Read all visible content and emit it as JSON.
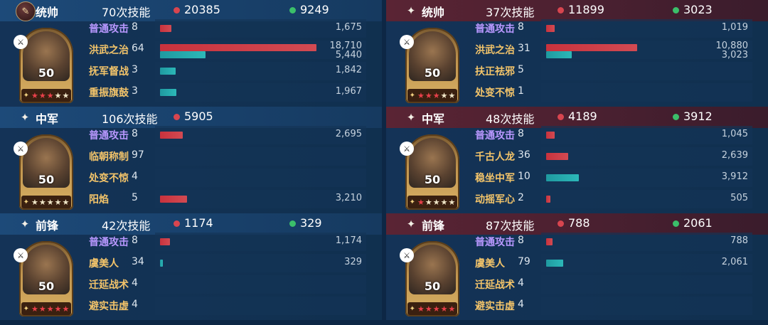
{
  "left": {
    "sections": [
      {
        "role": "统帅",
        "role_icon": "commander-badge-icon",
        "skill_count": "70次技能",
        "damage": "20385",
        "heal": "9249",
        "level": "50",
        "stars": 3,
        "skills": [
          {
            "name": "普通攻击",
            "color": "purple",
            "count": "8",
            "damage": "1,675",
            "damage_frac": 0.071,
            "heal": "",
            "heal_frac": 0
          },
          {
            "name": "洪武之治",
            "color": "gold",
            "count": "64",
            "damage": "18,710",
            "damage_frac": 1.0,
            "heal": "5,440",
            "heal_frac": 0.29
          },
          {
            "name": "抚军督战",
            "color": "gold",
            "count": "3",
            "damage": "",
            "damage_frac": 0,
            "heal": "1,842",
            "heal_frac": 0.098
          },
          {
            "name": "重振旗鼓",
            "color": "gold",
            "count": "3",
            "damage": "",
            "damage_frac": 0,
            "heal": "1,967",
            "heal_frac": 0.105
          }
        ]
      },
      {
        "role": "中军",
        "role_icon": "sparkle-icon",
        "skill_count": "106次技能",
        "damage": "5905",
        "heal": "",
        "level": "50",
        "stars": 0,
        "skills": [
          {
            "name": "普通攻击",
            "color": "purple",
            "count": "8",
            "damage": "2,695",
            "damage_frac": 0.144,
            "heal": "",
            "heal_frac": 0
          },
          {
            "name": "临朝称制",
            "color": "gold",
            "count": "97",
            "damage": "",
            "damage_frac": 0,
            "heal": "",
            "heal_frac": 0
          },
          {
            "name": "处变不惊",
            "color": "gold",
            "count": "4",
            "damage": "",
            "damage_frac": 0,
            "heal": "",
            "heal_frac": 0
          },
          {
            "name": "阳焰",
            "color": "gold",
            "count": "5",
            "damage": "3,210",
            "damage_frac": 0.172,
            "heal": "",
            "heal_frac": 0
          }
        ]
      },
      {
        "role": "前锋",
        "role_icon": "sparkle-icon",
        "skill_count": "42次技能",
        "damage": "1174",
        "heal": "329",
        "level": "50",
        "stars": 5,
        "skills": [
          {
            "name": "普通攻击",
            "color": "purple",
            "count": "8",
            "damage": "1,174",
            "damage_frac": 0.063,
            "heal": "",
            "heal_frac": 0
          },
          {
            "name": "虞美人",
            "color": "gold",
            "count": "34",
            "damage": "",
            "damage_frac": 0,
            "heal": "329",
            "heal_frac": 0.018
          },
          {
            "name": "迁延战术",
            "color": "gold",
            "count": "4",
            "damage": "",
            "damage_frac": 0,
            "heal": "",
            "heal_frac": 0
          },
          {
            "name": "避实击虚",
            "color": "gold",
            "count": "4",
            "damage": "",
            "damage_frac": 0,
            "heal": "",
            "heal_frac": 0
          }
        ]
      }
    ]
  },
  "right": {
    "sections": [
      {
        "role": "统帅",
        "role_icon": "sparkle-icon",
        "skill_count": "37次技能",
        "damage": "11899",
        "heal": "3023",
        "level": "50",
        "stars": 3,
        "skills": [
          {
            "name": "普通攻击",
            "color": "purple",
            "count": "8",
            "damage": "1,019",
            "damage_frac": 0.054,
            "heal": "",
            "heal_frac": 0
          },
          {
            "name": "洪武之治",
            "color": "gold",
            "count": "31",
            "damage": "10,880",
            "damage_frac": 0.581,
            "heal": "3,023",
            "heal_frac": 0.162
          },
          {
            "name": "扶正祛邪",
            "color": "gold",
            "count": "5",
            "damage": "",
            "damage_frac": 0,
            "heal": "",
            "heal_frac": 0
          },
          {
            "name": "处变不惊",
            "color": "gold",
            "count": "1",
            "damage": "",
            "damage_frac": 0,
            "heal": "",
            "heal_frac": 0
          }
        ]
      },
      {
        "role": "中军",
        "role_icon": "sparkle-icon",
        "skill_count": "48次技能",
        "damage": "4189",
        "heal": "3912",
        "level": "50",
        "stars": 1,
        "skills": [
          {
            "name": "普通攻击",
            "color": "purple",
            "count": "8",
            "damage": "1,045",
            "damage_frac": 0.056,
            "heal": "",
            "heal_frac": 0
          },
          {
            "name": "千古人龙",
            "color": "gold",
            "count": "36",
            "damage": "2,639",
            "damage_frac": 0.141,
            "heal": "",
            "heal_frac": 0
          },
          {
            "name": "稳坐中军",
            "color": "gold",
            "count": "10",
            "damage": "",
            "damage_frac": 0,
            "heal": "3,912",
            "heal_frac": 0.209
          },
          {
            "name": "动摇军心",
            "color": "gold",
            "count": "2",
            "damage": "505",
            "damage_frac": 0.027,
            "heal": "",
            "heal_frac": 0
          }
        ]
      },
      {
        "role": "前锋",
        "role_icon": "sparkle-icon",
        "skill_count": "87次技能",
        "damage": "788",
        "heal": "2061",
        "level": "50",
        "stars": 5,
        "skills": [
          {
            "name": "普通攻击",
            "color": "purple",
            "count": "8",
            "damage": "788",
            "damage_frac": 0.042,
            "heal": "",
            "heal_frac": 0
          },
          {
            "name": "虞美人",
            "color": "gold",
            "count": "79",
            "damage": "",
            "damage_frac": 0,
            "heal": "2,061",
            "heal_frac": 0.11
          },
          {
            "name": "迁延战术",
            "color": "gold",
            "count": "4",
            "damage": "",
            "damage_frac": 0,
            "heal": "",
            "heal_frac": 0
          },
          {
            "name": "避实击虚",
            "color": "gold",
            "count": "4",
            "damage": "",
            "damage_frac": 0,
            "heal": "",
            "heal_frac": 0
          }
        ]
      }
    ]
  },
  "colors": {
    "damage_bar": "#cc3a44",
    "heal_bar": "#26aaae",
    "skill_purple": "#b998ff",
    "skill_gold": "#f3c46a"
  }
}
